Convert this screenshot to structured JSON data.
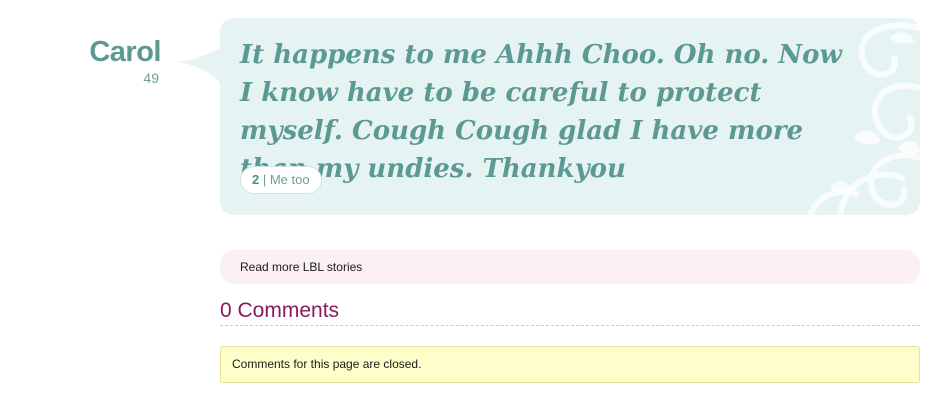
{
  "author": {
    "name": "Carol",
    "age": "49"
  },
  "story": {
    "text": "It happens to me Ahhh Choo. Oh no. Now I know have to be careful to protect myself. Cough Cough glad I have more than my undies. Thankyou",
    "metoo_count": "2",
    "metoo_separator": " | ",
    "metoo_label": "Me too"
  },
  "links": {
    "read_more": "Read more LBL stories"
  },
  "comments": {
    "title": "0 Comments",
    "closed_notice": "Comments for this page are closed."
  },
  "colors": {
    "bubble_bg": "#e6f3f3",
    "teal_text": "#5c9993",
    "readmore_bg": "#fbf1f4",
    "comments_title": "#8a1a5e",
    "notice_bg": "#fefecb"
  },
  "icons": {
    "bubble_decoration": "swirl-ornament-icon"
  }
}
